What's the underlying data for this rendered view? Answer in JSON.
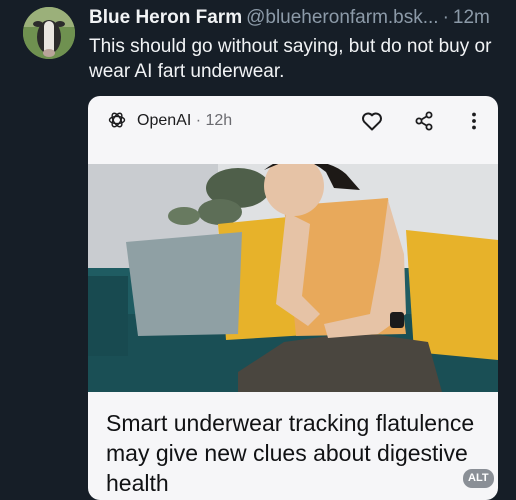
{
  "post": {
    "author_name": "Blue Heron Farm",
    "author_handle": "@blueheronfarm.bsk...",
    "separator": "·",
    "time": "12m",
    "text": "This should go without saying, but do not buy or wear AI fart underwear."
  },
  "embed": {
    "source_name": "OpenAI",
    "source_separator": "·",
    "source_time": "12h",
    "headline": "Smart underwear tracking flatulence may give new clues about digestive health",
    "alt_label": "ALT",
    "icons": [
      "openai-logo",
      "heart-icon",
      "share-icon",
      "more-vertical-icon"
    ]
  },
  "colors": {
    "background": "#161e27",
    "card": "#f6f6f8",
    "muted_text": "#8c9aa8",
    "sofa_teal": "#1f5c62",
    "pillow_yellow": "#e7b22a",
    "shirt": "#e8a95b"
  }
}
